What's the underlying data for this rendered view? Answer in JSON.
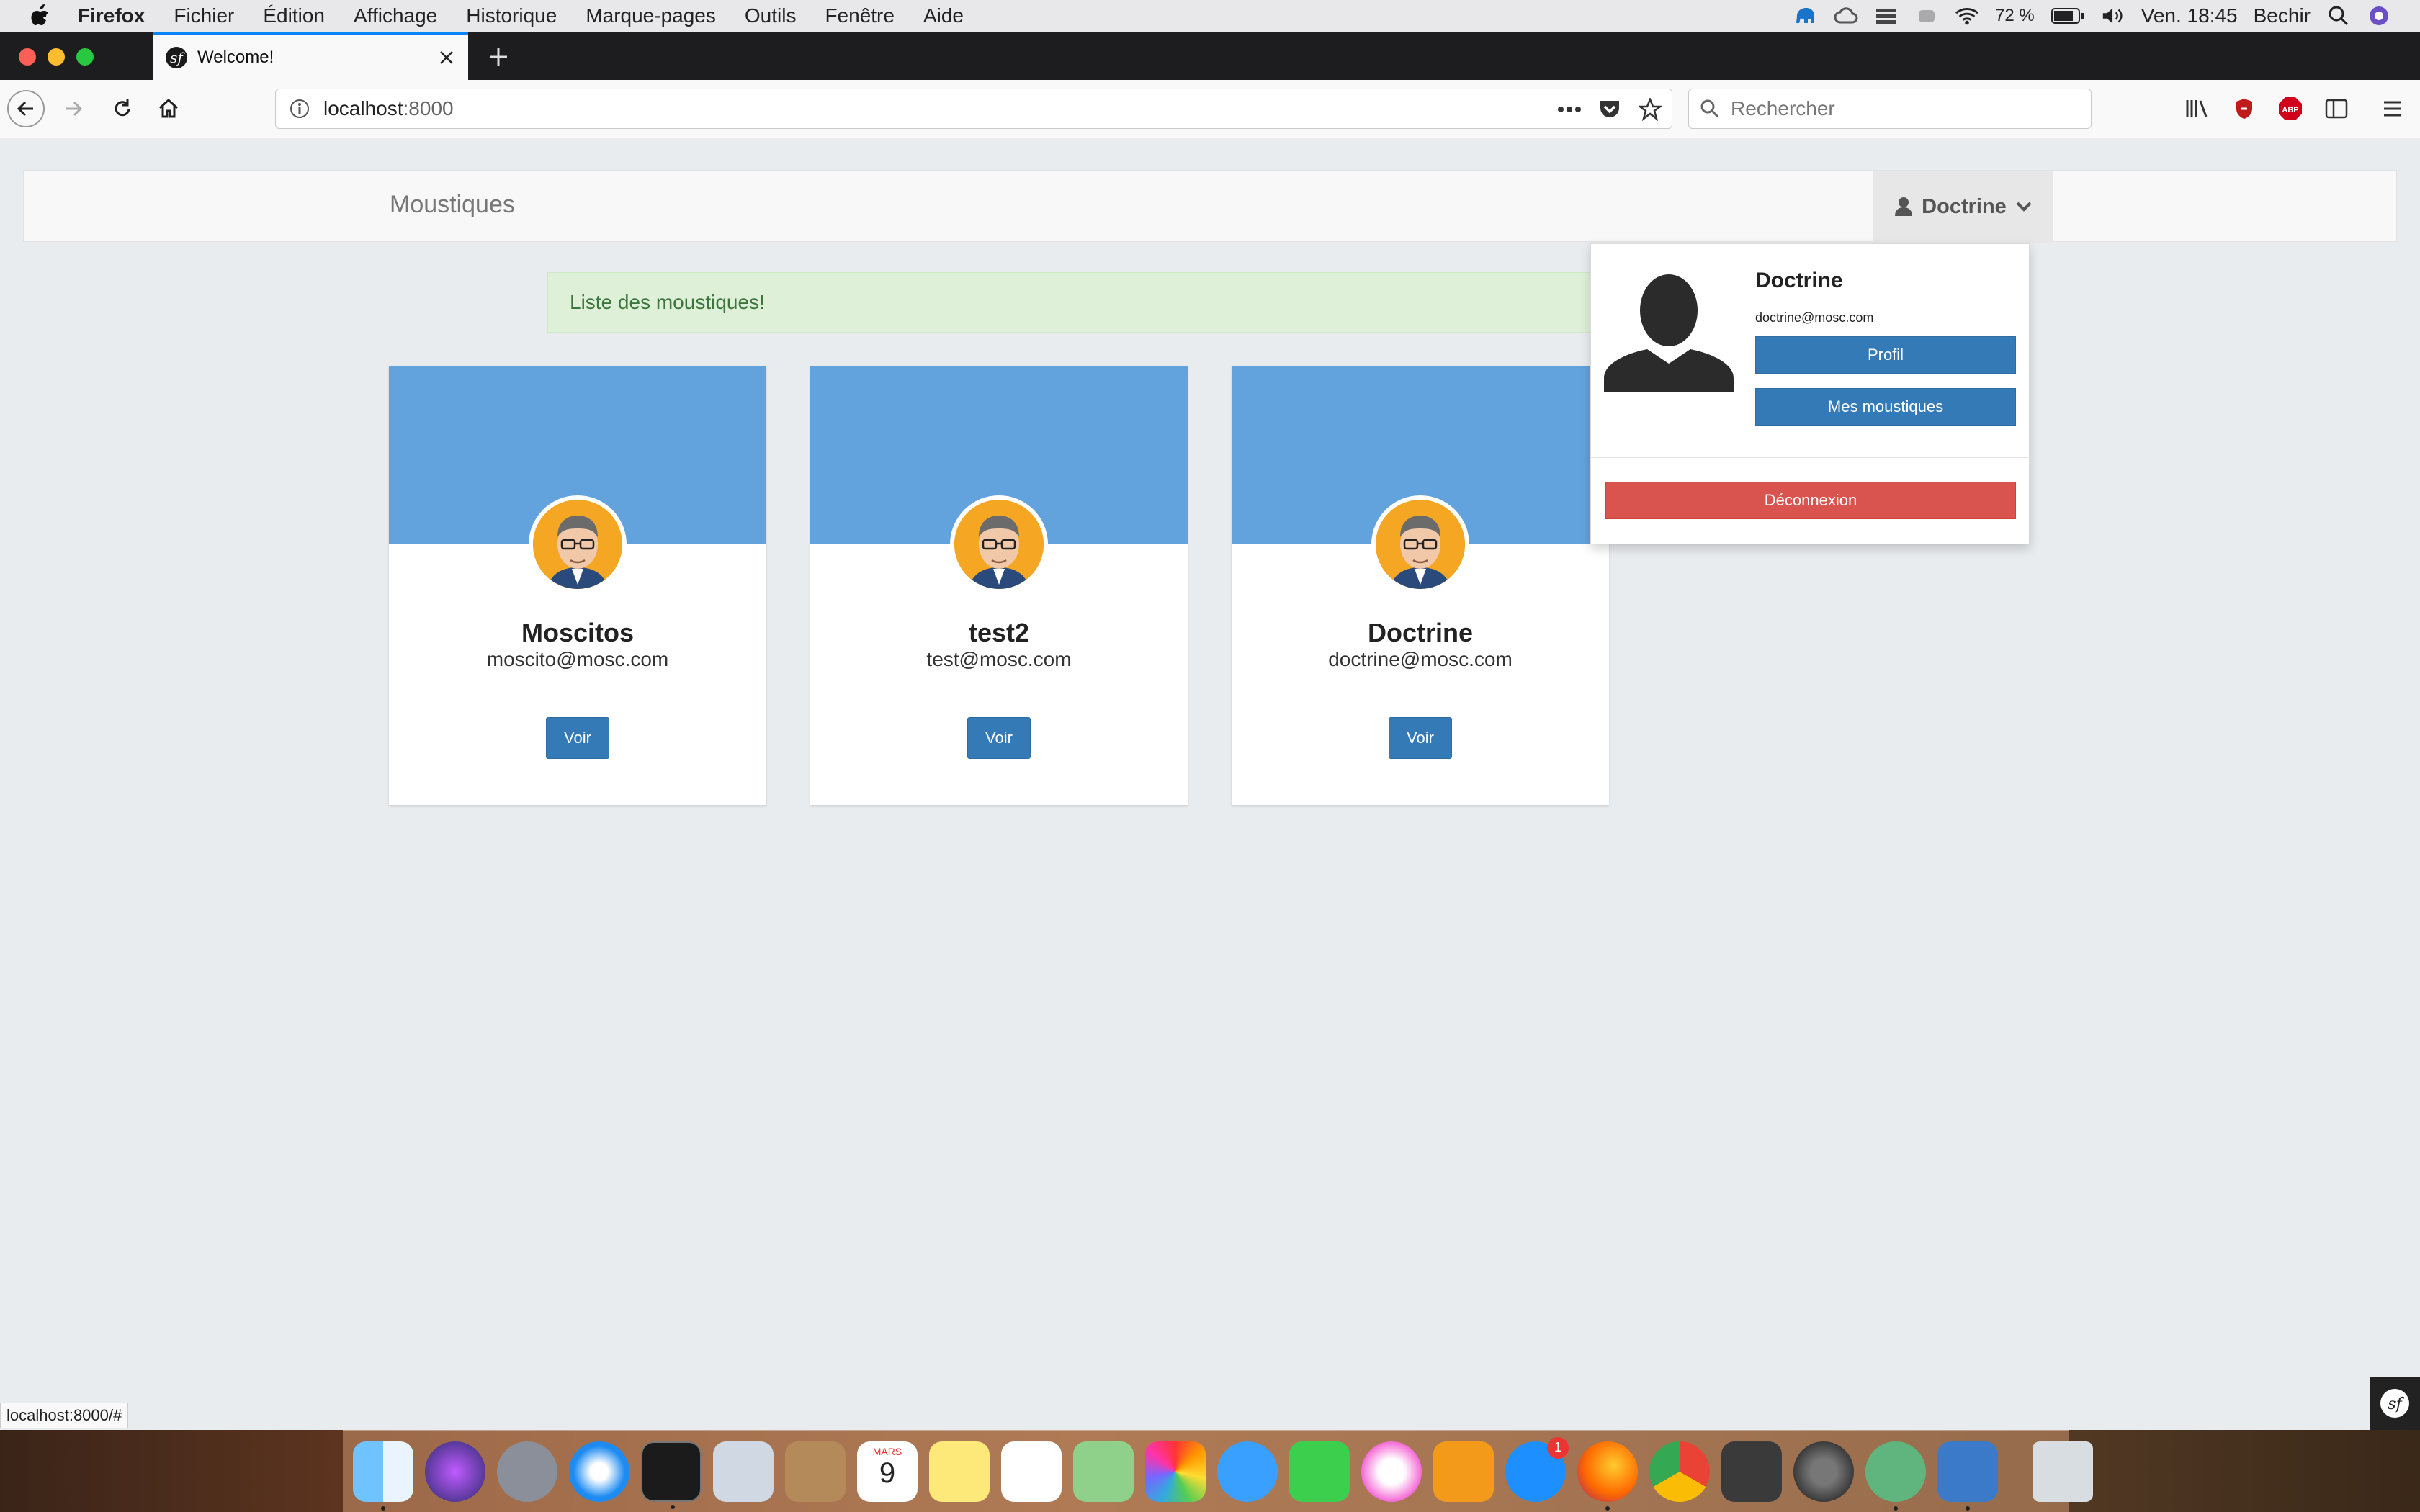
{
  "menubar": {
    "app_name": "Firefox",
    "items": [
      "Fichier",
      "Édition",
      "Affichage",
      "Historique",
      "Marque-pages",
      "Outils",
      "Fenêtre",
      "Aide"
    ],
    "battery": "72 %",
    "clock": "Ven. 18:45",
    "user": "Bechir"
  },
  "browser": {
    "tab_title": "Welcome!",
    "url_host": "localhost",
    "url_port": ":8000",
    "search_placeholder": "Rechercher",
    "status_url": "localhost:8000/#"
  },
  "site": {
    "brand": "Moustiques",
    "user_menu_label": "Doctrine",
    "alert": "Liste des moustiques!",
    "cards": [
      {
        "name": "Moscitos",
        "email": "moscito@mosc.com",
        "button": "Voir"
      },
      {
        "name": "test2",
        "email": "test@mosc.com",
        "button": "Voir"
      },
      {
        "name": "Doctrine",
        "email": "doctrine@mosc.com",
        "button": "Voir"
      }
    ],
    "dropdown": {
      "name": "Doctrine",
      "email": "doctrine@mosc.com",
      "profile_button": "Profil",
      "my_button": "Mes moustiques",
      "logout_button": "Déconnexion"
    }
  },
  "calendar_icon": {
    "month": "MARS",
    "day": "9"
  },
  "app_store_badge": "1",
  "colors": {
    "cover": "#62a2dd",
    "primary": "#337ab7",
    "danger": "#d9534f",
    "alert_bg": "#dff0d8",
    "alert_text": "#3c763d"
  }
}
